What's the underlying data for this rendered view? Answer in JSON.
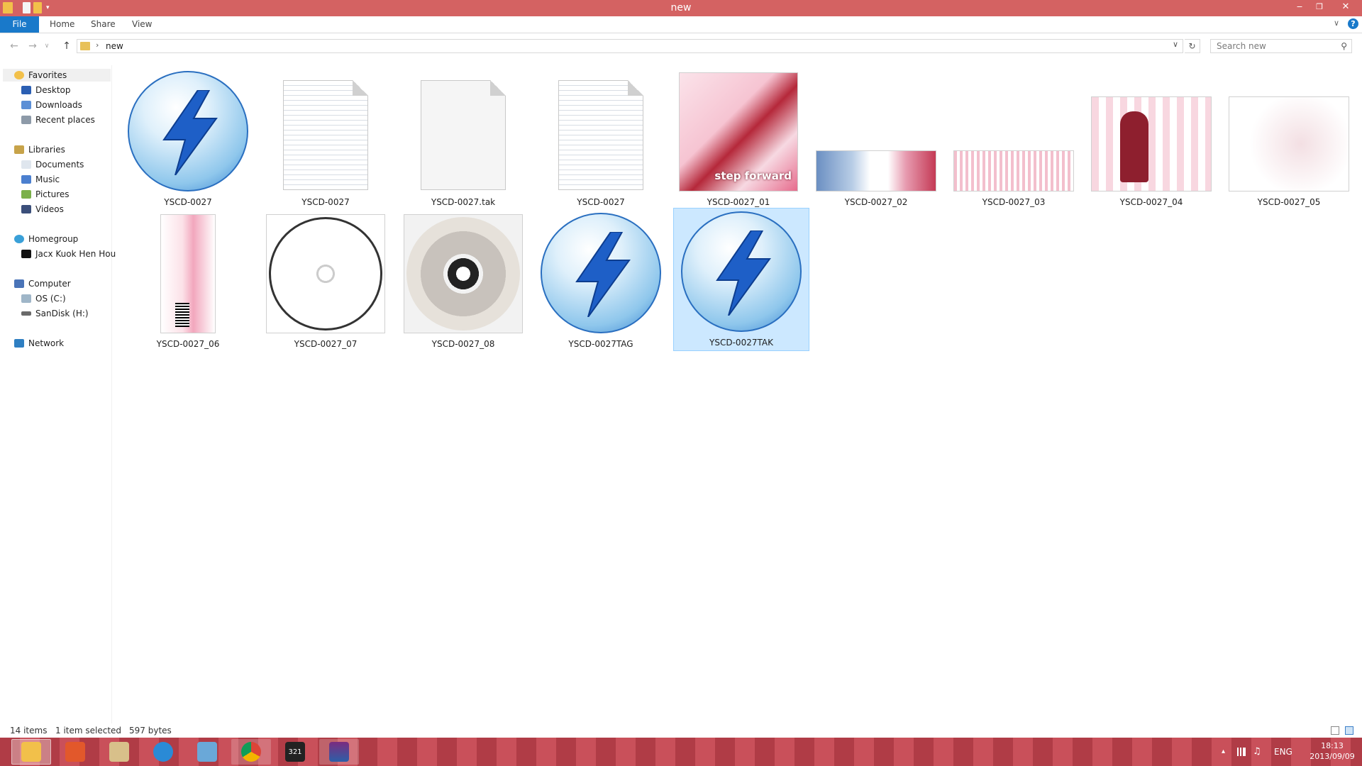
{
  "window": {
    "title": "new",
    "minimize": "‒",
    "maximize": "❐",
    "close": "✕"
  },
  "ribbon": {
    "tabs": [
      "File",
      "Home",
      "Share",
      "View"
    ],
    "help": "?",
    "expand": "∨"
  },
  "address": {
    "crumb": "new",
    "separator": "›",
    "dropdown": "∨",
    "refresh": "↻",
    "search_placeholder": "Search new",
    "back": "←",
    "forward": "→",
    "recent": "∨",
    "up": "↑"
  },
  "nav": {
    "favorites": "Favorites",
    "desktop": "Desktop",
    "downloads": "Downloads",
    "recent": "Recent places",
    "libraries": "Libraries",
    "documents": "Documents",
    "music": "Music",
    "pictures": "Pictures",
    "videos": "Videos",
    "homegroup": "Homegroup",
    "user": "Jacx Kuok Hen Hou",
    "computer": "Computer",
    "osc": "OS (C:)",
    "sandisk": "SanDisk (H:)",
    "network": "Network"
  },
  "files": [
    {
      "name": "YSCD-0027",
      "kind": "daemon"
    },
    {
      "name": "YSCD-0027",
      "kind": "text"
    },
    {
      "name": "YSCD-0027.tak",
      "kind": "blank"
    },
    {
      "name": "YSCD-0027",
      "kind": "text"
    },
    {
      "name": "YSCD-0027_01",
      "kind": "image",
      "caption": "step forward"
    },
    {
      "name": "YSCD-0027_02",
      "kind": "image"
    },
    {
      "name": "YSCD-0027_03",
      "kind": "image"
    },
    {
      "name": "YSCD-0027_04",
      "kind": "image"
    },
    {
      "name": "YSCD-0027_05",
      "kind": "image"
    },
    {
      "name": "YSCD-0027_06",
      "kind": "image"
    },
    {
      "name": "YSCD-0027_07",
      "kind": "cd-art"
    },
    {
      "name": "YSCD-0027_08",
      "kind": "cd"
    },
    {
      "name": "YSCD-0027TAG",
      "kind": "daemon"
    },
    {
      "name": "YSCD-0027TAK",
      "kind": "daemon",
      "selected": true
    }
  ],
  "status": {
    "count": "14 items",
    "selected": "1 item selected",
    "size": "597 bytes"
  },
  "tray": {
    "lang": "ENG",
    "time": "18:13",
    "date": "2013/09/09",
    "arrow": "▴"
  },
  "taskbar": {
    "wmp_label": "321"
  },
  "colors": {
    "accent": "#1979ca",
    "titlebar": "#d46262",
    "selection": "#cce8ff"
  }
}
